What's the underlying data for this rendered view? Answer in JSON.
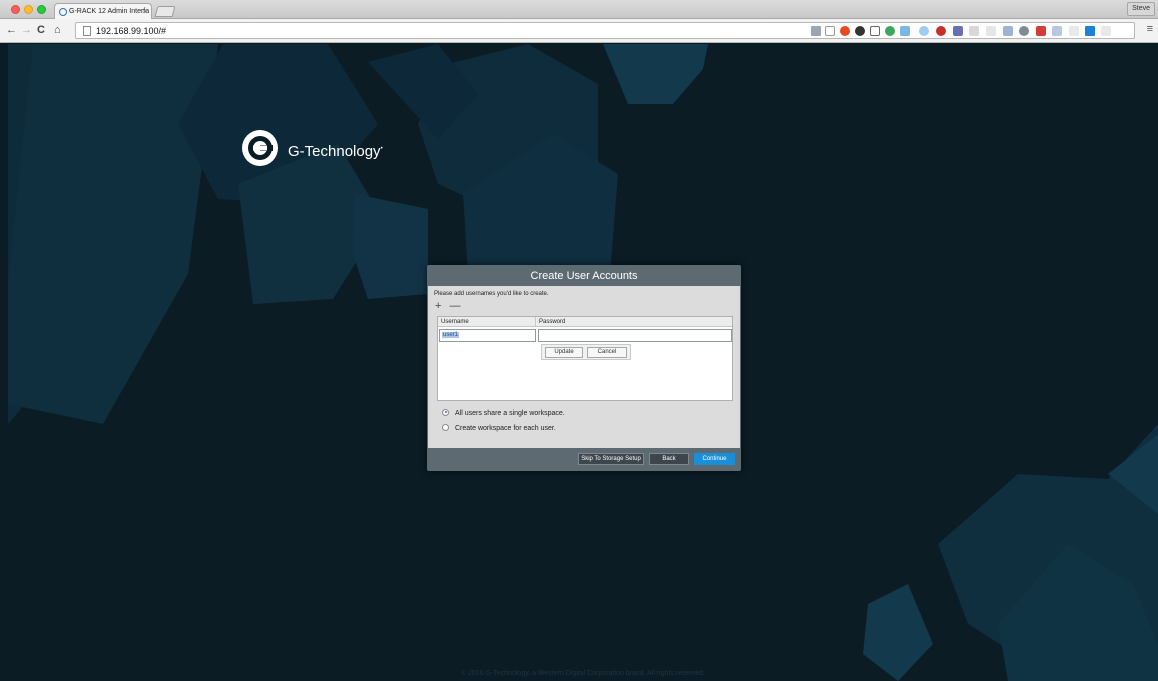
{
  "browser": {
    "tab_title": "G-RACK 12 Admin Interfa",
    "tab_close": "×",
    "profile_name": "Steve",
    "url": "192.168.99.100/#",
    "nav": {
      "back": "←",
      "forward": "→",
      "reload": "C",
      "home": "⌂"
    },
    "menu_icon": "≡"
  },
  "page": {
    "brand_name": "G-Technology",
    "brand_mark": "•",
    "footer_text": "© 2016 G-Technology, a Western Digital Corporation brand. All rights reserved."
  },
  "dialog": {
    "title": "Create User Accounts",
    "instructions": "Please add usernames you'd like to create.",
    "add_symbol": "+",
    "remove_symbol": "—",
    "columns": {
      "username": "Username",
      "password": "Password"
    },
    "row": {
      "username": "user1",
      "password": ""
    },
    "update_label": "Update",
    "cancel_label": "Cancel",
    "options": [
      {
        "label": "All users share a single workspace.",
        "selected": true
      },
      {
        "label": "Create workspace for each user.",
        "selected": false
      }
    ],
    "skip_label": "Skip To Storage Setup",
    "back_label": "Back",
    "continue_label": "Continue"
  },
  "colors": {
    "dialog_header": "#5d6a72",
    "continue_button": "#1a8fd8",
    "page_background": "#0b1c25"
  }
}
